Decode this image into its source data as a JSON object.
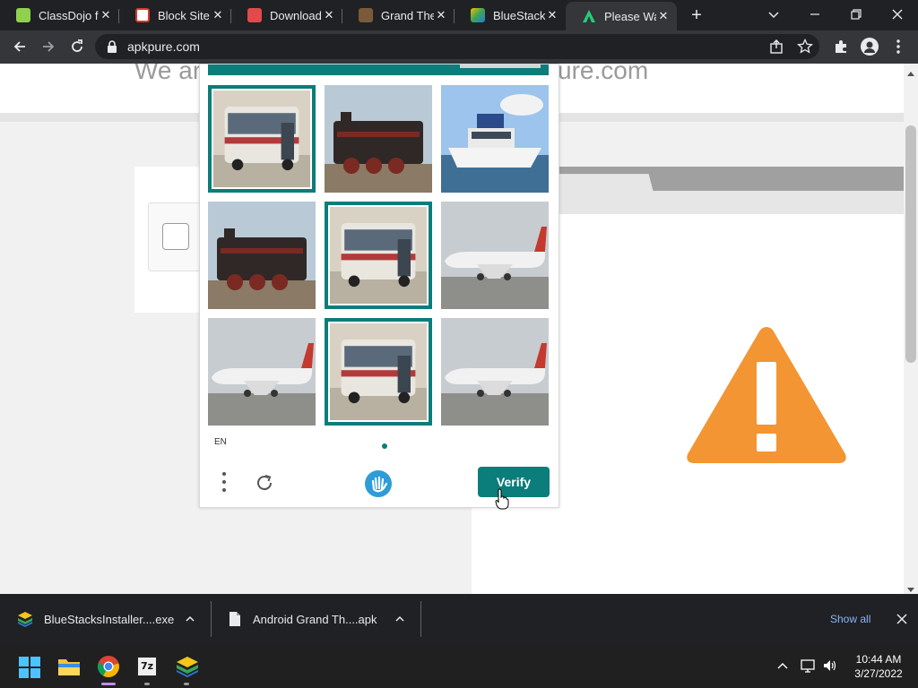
{
  "tabs": [
    {
      "title": "ClassDojo f",
      "favicon": "classdojo-icon"
    },
    {
      "title": "Block Site P",
      "favicon": "block-site-icon"
    },
    {
      "title": "Download",
      "favicon": "download-icon"
    },
    {
      "title": "Grand Theft",
      "favicon": "gta-icon"
    },
    {
      "title": "BlueStacks",
      "favicon": "bluestacks-icon"
    },
    {
      "title": "Please Wai",
      "favicon": "apkpure-icon",
      "active": true
    }
  ],
  "address_bar": {
    "url": "apkpure.com"
  },
  "page": {
    "heading_left": "We ar",
    "heading_right": "ure.com"
  },
  "captcha": {
    "language": "EN",
    "verify_label": "Verify",
    "tiles": [
      {
        "subject": "bus",
        "selected": true
      },
      {
        "subject": "train",
        "selected": false
      },
      {
        "subject": "boat",
        "selected": false
      },
      {
        "subject": "train",
        "selected": false
      },
      {
        "subject": "bus",
        "selected": true
      },
      {
        "subject": "airplane",
        "selected": false
      },
      {
        "subject": "airplane",
        "selected": false
      },
      {
        "subject": "bus",
        "selected": true
      },
      {
        "subject": "airplane",
        "selected": false
      }
    ],
    "accent_color": "#0b7d7a"
  },
  "downloads": [
    {
      "name": "BlueStacksInstaller....exe"
    },
    {
      "name": "Android Grand Th....apk"
    }
  ],
  "downloads_show_all": "Show all",
  "taskbar": {
    "time": "10:44 AM",
    "date": "3/27/2022"
  },
  "colors": {
    "warning": "#f39533"
  }
}
